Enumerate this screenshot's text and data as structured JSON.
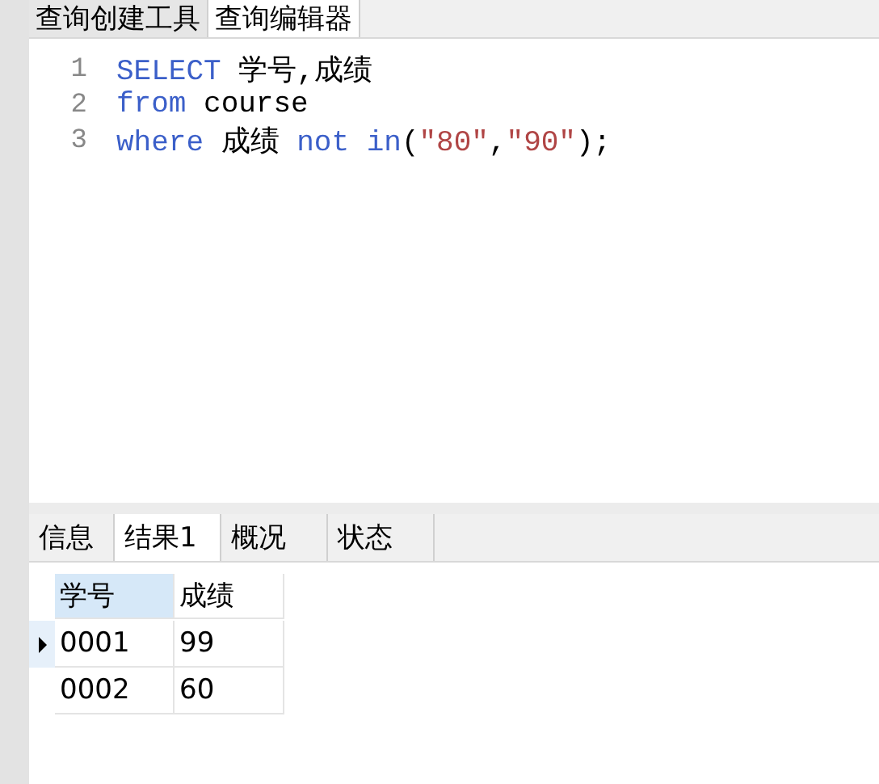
{
  "top_tabs": [
    {
      "label": "查询创建工具",
      "selected": false
    },
    {
      "label": "查询编辑器",
      "selected": true
    }
  ],
  "editor": {
    "lines": [
      {
        "number": "1",
        "tokens": [
          {
            "kind": "keyword",
            "text": "SELECT"
          },
          {
            "kind": "plain",
            "text": " 学号,成绩"
          }
        ]
      },
      {
        "number": "2",
        "tokens": [
          {
            "kind": "keyword",
            "text": "from"
          },
          {
            "kind": "plain",
            "text": " course"
          }
        ]
      },
      {
        "number": "3",
        "tokens": [
          {
            "kind": "keyword",
            "text": "where"
          },
          {
            "kind": "plain",
            "text": " 成绩 "
          },
          {
            "kind": "keyword",
            "text": "not in"
          },
          {
            "kind": "plain",
            "text": "("
          },
          {
            "kind": "string",
            "text": "\"80\""
          },
          {
            "kind": "plain",
            "text": ","
          },
          {
            "kind": "string",
            "text": "\"90\""
          },
          {
            "kind": "plain",
            "text": ");"
          }
        ]
      }
    ]
  },
  "result_tabs": [
    {
      "label": "信息",
      "selected": false
    },
    {
      "label": "结果1",
      "selected": true
    },
    {
      "label": "概况",
      "selected": false
    },
    {
      "label": "状态",
      "selected": false
    }
  ],
  "table": {
    "columns": [
      {
        "label": "学号",
        "selected": true
      },
      {
        "label": "成绩",
        "selected": false
      }
    ],
    "rows": [
      {
        "cells": [
          "0001",
          "99"
        ],
        "selected": true
      },
      {
        "cells": [
          "0002",
          "60"
        ],
        "selected": false
      }
    ]
  }
}
